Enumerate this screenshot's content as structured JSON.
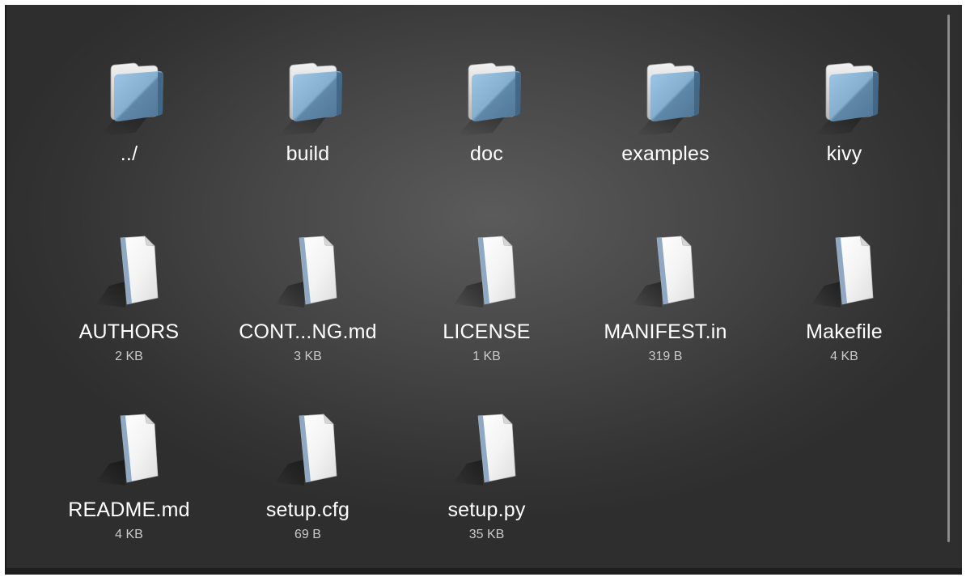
{
  "file_chooser": {
    "entries": [
      {
        "name": "../",
        "size": "",
        "kind": "folder",
        "icon": "folder-icon"
      },
      {
        "name": "build",
        "size": "",
        "kind": "folder",
        "icon": "folder-icon"
      },
      {
        "name": "doc",
        "size": "",
        "kind": "folder",
        "icon": "folder-icon"
      },
      {
        "name": "examples",
        "size": "",
        "kind": "folder",
        "icon": "folder-icon"
      },
      {
        "name": "kivy",
        "size": "",
        "kind": "folder",
        "icon": "folder-icon"
      },
      {
        "name": "AUTHORS",
        "size": "2 KB",
        "kind": "file",
        "icon": "file-icon"
      },
      {
        "name": "CONT...NG.md",
        "size": "3 KB",
        "kind": "file",
        "icon": "file-icon"
      },
      {
        "name": "LICENSE",
        "size": "1 KB",
        "kind": "file",
        "icon": "file-icon"
      },
      {
        "name": "MANIFEST.in",
        "size": "319 B",
        "kind": "file",
        "icon": "file-icon"
      },
      {
        "name": "Makefile",
        "size": "4 KB",
        "kind": "file",
        "icon": "file-icon"
      },
      {
        "name": "README.md",
        "size": "4 KB",
        "kind": "file",
        "icon": "file-icon"
      },
      {
        "name": "setup.cfg",
        "size": "69 B",
        "kind": "file",
        "icon": "file-icon"
      },
      {
        "name": "setup.py",
        "size": "35 KB",
        "kind": "file",
        "icon": "file-icon"
      }
    ]
  }
}
